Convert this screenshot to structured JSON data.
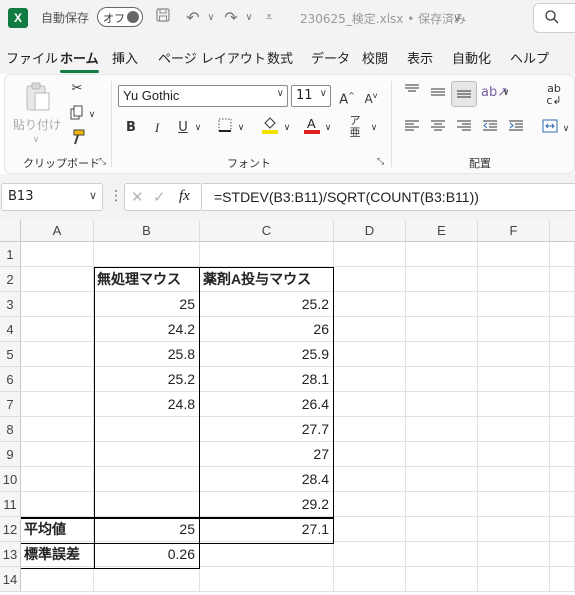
{
  "titlebar": {
    "app_logo": "X",
    "autosave_label": "自動保存",
    "toggle_text": "オフ",
    "save_icon": "save-icon",
    "filename": "230625_検定.xlsx • 保存済み",
    "chevron": "∨",
    "search_icon": "search-icon"
  },
  "menu": {
    "tabs": [
      "ファイル",
      "ホーム",
      "挿入",
      "ページ レイアウト",
      "数式",
      "データ",
      "校閲",
      "表示",
      "自動化",
      "ヘルプ"
    ],
    "active": "ホーム"
  },
  "ribbon": {
    "clipboard": {
      "paste_label": "貼り付け",
      "group_label": "クリップボード"
    },
    "font": {
      "font_name": "Yu Gothic",
      "font_size": "11",
      "group_label": "フォント",
      "bold": "B",
      "italic": "I",
      "underline": "U",
      "font_color": "#e02020",
      "fill_color": "#f2e200"
    },
    "alignment": {
      "group_label": "配置"
    }
  },
  "formula_bar": {
    "name_box": "B13",
    "formula": "=STDEV(B3:B11)/SQRT(COUNT(B3:B11))"
  },
  "sheet": {
    "columns": [
      "A",
      "B",
      "C",
      "D",
      "E",
      "F"
    ],
    "rows": [
      "1",
      "2",
      "3",
      "4",
      "5",
      "6",
      "7",
      "8",
      "9",
      "10",
      "11",
      "12",
      "13",
      "14"
    ],
    "cells": {
      "B2": "無処理マウス",
      "C2": "薬剤A投与マウス",
      "B3": "25",
      "C3": "25.2",
      "B4": "24.2",
      "C4": "26",
      "B5": "25.8",
      "C5": "25.9",
      "B6": "25.2",
      "C6": "28.1",
      "B7": "24.8",
      "C7": "26.4",
      "C8": "27.7",
      "C9": "27",
      "C10": "28.4",
      "C11": "29.2",
      "A12": "平均値",
      "B12": "25",
      "C12": "27.1",
      "A13": "標準誤差",
      "B13": "0.26"
    }
  }
}
